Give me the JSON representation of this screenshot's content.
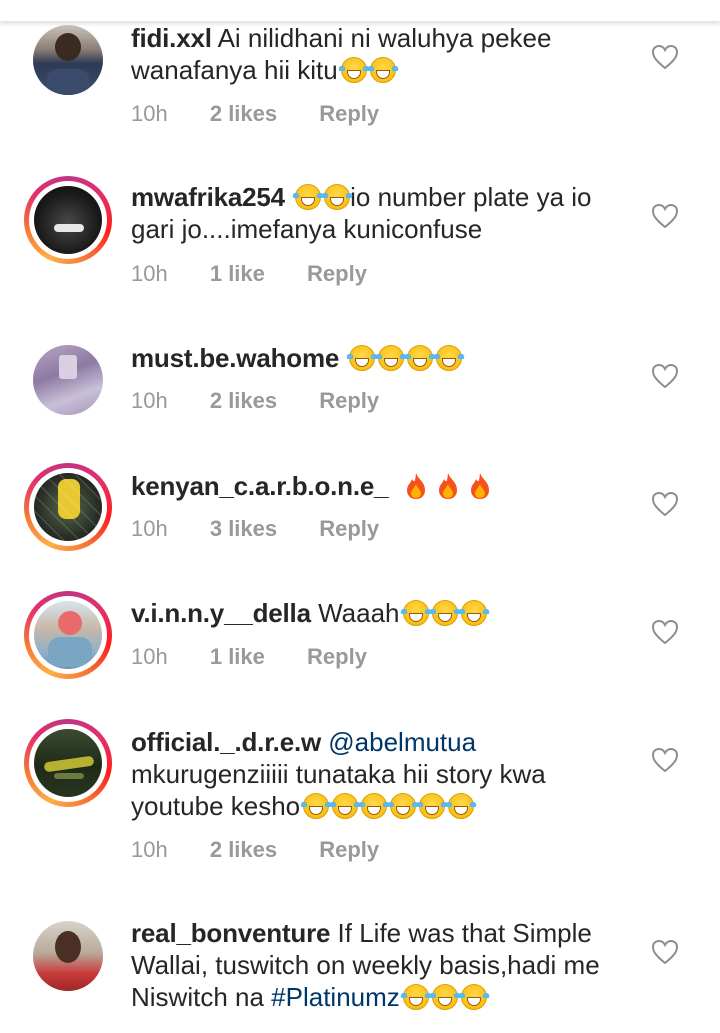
{
  "comments": [
    {
      "username": "fidi.xxl",
      "text": "Ai nilidhani ni waluhya pekee wanafanya hii kitu",
      "emoji_count": 2,
      "time": "10h",
      "likes": "2 likes",
      "reply": "Reply"
    },
    {
      "username": "mwafrika254",
      "text": "io number plate ya io gari jo....imefanya kuniconfuse",
      "emoji_count": 2,
      "time": "10h",
      "likes": "1 like",
      "reply": "Reply"
    },
    {
      "username": "must.be.wahome",
      "text": "",
      "emoji_count": 4,
      "time": "10h",
      "likes": "2 likes",
      "reply": "Reply"
    },
    {
      "username": "kenyan_c.a.r.b.o.n.e_",
      "text": "",
      "fire_count": 3,
      "time": "10h",
      "likes": "3 likes",
      "reply": "Reply"
    },
    {
      "username": "v.i.n.n.y__della",
      "text": "Waaah",
      "emoji_count": 3,
      "time": "10h",
      "likes": "1 like",
      "reply": "Reply"
    },
    {
      "username": "official._.d.r.e.w",
      "mention": "@abelmutua",
      "text": "mkurugenziiiii tunataka hii story kwa youtube kesho",
      "emoji_count": 6,
      "time": "10h",
      "likes": "2 likes",
      "reply": "Reply"
    },
    {
      "username": "real_bonventure",
      "text": "If Life was that Simple Wallai, tuswitch on weekly basis,hadi me Niswitch na",
      "hashtag": "#Platinumz",
      "emoji_count": 3
    }
  ],
  "colors": {
    "text": "#262626",
    "meta": "#999999",
    "mention": "#003569"
  },
  "icons": {
    "like": "heart-outline-icon",
    "emoji": "tears-of-joy-emoji-icon",
    "fire": "fire-emoji-icon"
  }
}
